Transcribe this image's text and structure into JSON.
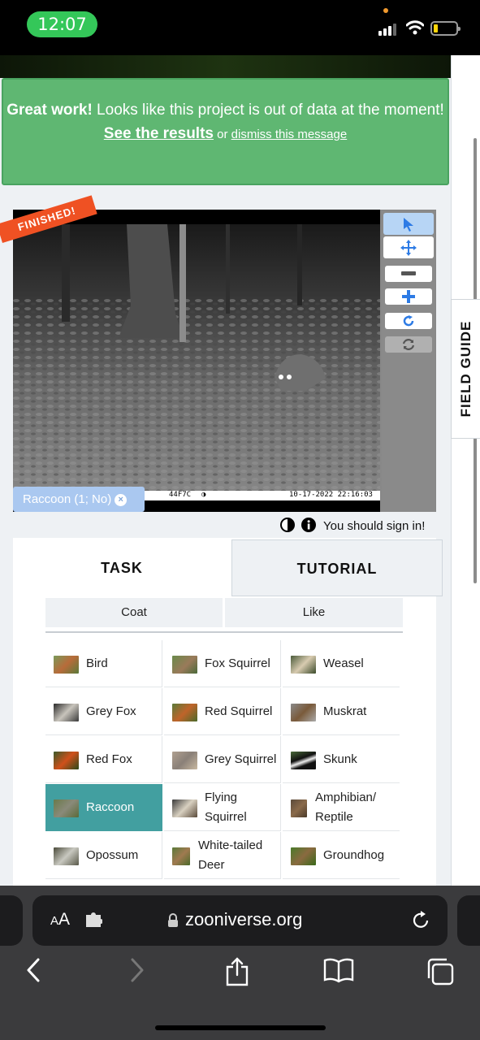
{
  "status": {
    "time": "12:07"
  },
  "message": {
    "bold": "Great work!",
    "text": " Looks like this project is out of data at the moment!",
    "results_link": "See the results",
    "or": " or ",
    "dismiss_link": "dismiss this message"
  },
  "viewer": {
    "ribbon": "FINISHED!",
    "camera_code": "44F7C",
    "timestamp": "10-17-2022 22:16:03",
    "annotation_tag": "Raccoon (1; No)",
    "tag_remove": "×"
  },
  "signin": {
    "text": "You should sign in!"
  },
  "side": {
    "field_guide": "FIELD GUIDE"
  },
  "tabs": {
    "task": "TASK",
    "tutorial": "TUTORIAL"
  },
  "filters": [
    "Coat",
    "Like"
  ],
  "species": [
    {
      "label": "Bird",
      "selected": false
    },
    {
      "label": "Fox Squirrel",
      "selected": false
    },
    {
      "label": "Weasel",
      "selected": false
    },
    {
      "label": "Grey Fox",
      "selected": false
    },
    {
      "label": "Red Squirrel",
      "selected": false
    },
    {
      "label": "Muskrat",
      "selected": false
    },
    {
      "label": "Red Fox",
      "selected": false
    },
    {
      "label": "Grey Squirrel",
      "selected": false
    },
    {
      "label": "Skunk",
      "selected": false
    },
    {
      "label": "Raccoon",
      "selected": true
    },
    {
      "label": "Flying Squirrel",
      "selected": false
    },
    {
      "label": "Amphibian/ Reptile",
      "selected": false
    },
    {
      "label": "Opossum",
      "selected": false
    },
    {
      "label": "White-tailed Deer",
      "selected": false
    },
    {
      "label": "Groundhog",
      "selected": false
    }
  ],
  "browser": {
    "aa_small": "A",
    "aa_large": "A",
    "url": "zooniverse.org"
  },
  "colors": {
    "message_green": "#5fb772",
    "selected_teal": "#429fa0",
    "ribbon_orange": "#ef5123",
    "tag_blue": "#aac8f0"
  }
}
